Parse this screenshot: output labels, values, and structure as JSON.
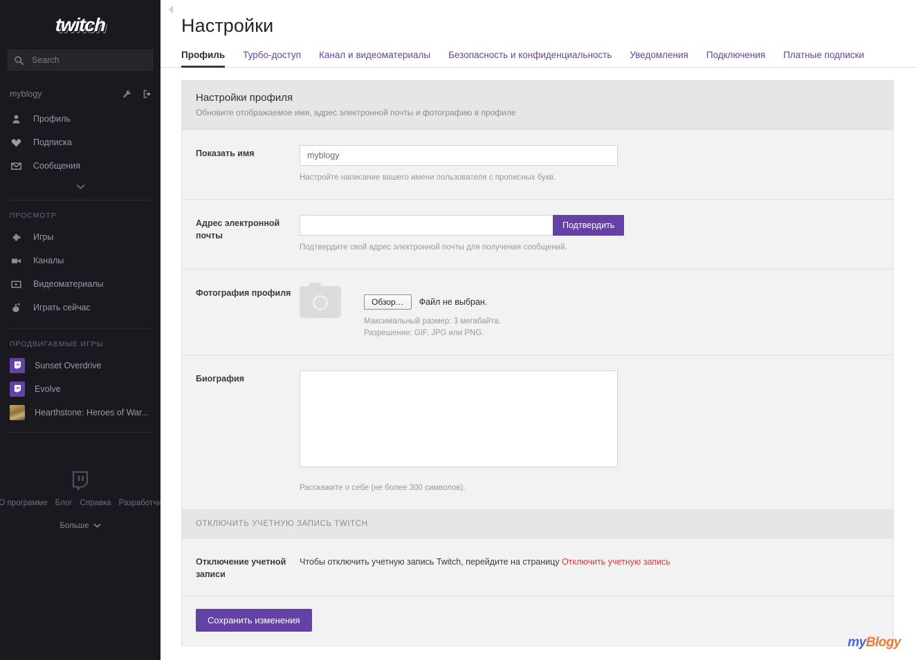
{
  "sidebar": {
    "logo_text": "twitch",
    "search": {
      "placeholder": "Search",
      "value": "",
      "icon": "search-icon"
    },
    "user": {
      "name": "myblogy",
      "settings_icon": "wrench-icon",
      "logout_icon": "logout-icon"
    },
    "account_nav": [
      {
        "label": "Профиль",
        "icon": "person-icon"
      },
      {
        "label": "Подписка",
        "icon": "heart-icon"
      },
      {
        "label": "Сообщения",
        "icon": "envelope-icon"
      }
    ],
    "expand_icon": "chevron-down-icon",
    "browse_section_title": "ПРОСМОТР",
    "browse_nav": [
      {
        "label": "Игры",
        "icon": "gamepad-icon"
      },
      {
        "label": "Каналы",
        "icon": "video-camera-icon"
      },
      {
        "label": "Видеоматериалы",
        "icon": "play-icon"
      },
      {
        "label": "Играть сейчас",
        "icon": "joystick-icon"
      }
    ],
    "featured_section_title": "ПРОДВИГАЕМЫЕ ИГРЫ",
    "featured_games": [
      {
        "label": "Sunset Overdrive",
        "thumb": "twitch-glitch-thumb"
      },
      {
        "label": "Evolve",
        "thumb": "twitch-glitch-thumb"
      },
      {
        "label": "Hearthstone: Heroes of War...",
        "thumb": "hearthstone-thumb"
      }
    ],
    "footer": {
      "logo_icon": "twitch-glitch-icon",
      "links": [
        "О программе",
        "Блог",
        "Справка",
        "Разработчи"
      ],
      "more_label": "Больше",
      "more_icon": "chevron-down-icon"
    }
  },
  "main": {
    "collapse_icon": "collapse-left-arrow-icon",
    "page_title": "Настройки",
    "tabs": [
      {
        "label": "Профиль",
        "active": true
      },
      {
        "label": "Турбо-доступ",
        "active": false
      },
      {
        "label": "Канал и видеоматериалы",
        "active": false
      },
      {
        "label": "Безопасность и конфиденциальность",
        "active": false
      },
      {
        "label": "Уведомления",
        "active": false
      },
      {
        "label": "Подключения",
        "active": false
      },
      {
        "label": "Платные подписки",
        "active": false
      }
    ],
    "panel": {
      "heading": "Настройки профиля",
      "subheading": "Обновите отображаемое имя, адрес электронной почты и фотографию в профиле",
      "display_name": {
        "label": "Показать имя",
        "value": "myblogy",
        "placeholder": "",
        "hint": "Настройте написание вашего имени пользователя с прописных букв."
      },
      "email": {
        "label": "Адрес электронной почты",
        "value": "",
        "placeholder": "",
        "button_label": "Подтвердить",
        "hint": "Подтвердите свой адрес электронной почты для получения сообщений."
      },
      "photo": {
        "label": "Фотография профиля",
        "avatar_icon": "camera-placeholder-icon",
        "browse_label": "Обзор…",
        "file_status": "Файл не выбран.",
        "hint": "Максимальный размер: 3 мегабайта. Разрешение: GIF, JPG или PNG."
      },
      "bio": {
        "label": "Биография",
        "value": "",
        "placeholder": "",
        "hint": "Расскажите о себе (не более 300 символов)."
      },
      "disable_section_title": "ОТКЛЮЧИТЬ УЧЕТНУЮ ЗАПИСЬ TWITCH",
      "disable": {
        "label": "Отключение учетной записи",
        "text_before": "Чтобы отключить учетную запись Twitch, перейдите на страницу ",
        "link_text": "Отключить учетную запись"
      },
      "save_label": "Сохранить изменения"
    },
    "watermark": {
      "part1": "my",
      "part2": "Blogy"
    }
  },
  "colors": {
    "sidebar_bg": "#19191f",
    "accent_purple": "#6441a5",
    "panel_bg": "#f2f2f2",
    "panel_head_bg": "#e6e6e6",
    "danger_red": "#d33b3b",
    "watermark_blue": "#4f66d4",
    "watermark_orange": "#ef7a3a"
  }
}
